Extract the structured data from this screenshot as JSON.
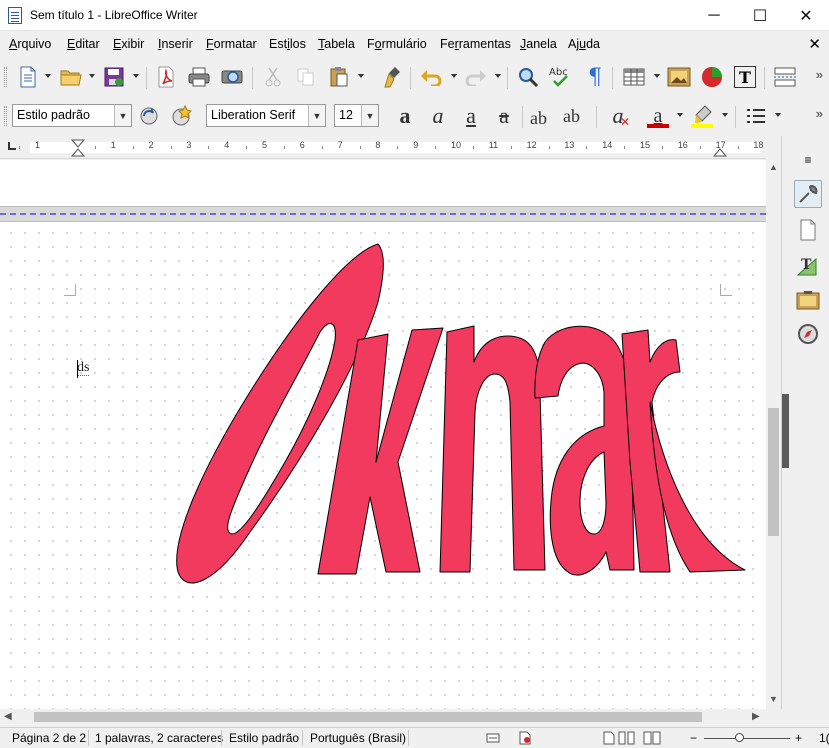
{
  "window": {
    "title": "Sem título 1 - LibreOffice Writer",
    "controls": {
      "minimize": "─",
      "maximize": "☐",
      "close": "✕"
    }
  },
  "menu": {
    "items": [
      {
        "accel": "A",
        "rest": "rquivo"
      },
      {
        "accel": "E",
        "rest": "ditar"
      },
      {
        "accel": "E",
        "rest": "xibir"
      },
      {
        "accel": "I",
        "rest": "nserir"
      },
      {
        "accel": "F",
        "rest": "ormatar"
      },
      {
        "pre": "Est",
        "accel": "i",
        "rest": "los"
      },
      {
        "accel": "T",
        "rest": "abela"
      },
      {
        "pre": "F",
        "accel": "o",
        "rest": "rmulário"
      },
      {
        "pre": "Fe",
        "accel": "r",
        "rest": "ramentas"
      },
      {
        "accel": "J",
        "rest": "anela"
      },
      {
        "pre": "Aj",
        "accel": "u",
        "rest": "da"
      }
    ],
    "close_doc": "✕"
  },
  "standard_toolbar": {
    "more": "»",
    "icons": [
      "new-document-icon",
      "open-icon",
      "save-icon",
      "export-pdf-icon",
      "print-icon",
      "print-preview-icon",
      "cut-icon",
      "copy-icon",
      "paste-icon",
      "clone-formatting-icon",
      "undo-icon",
      "redo-icon",
      "find-replace-icon",
      "spelling-icon",
      "formatting-marks-icon",
      "insert-table-icon",
      "insert-image-icon",
      "insert-chart-icon",
      "insert-textbox-icon",
      "insert-page-break-icon"
    ],
    "spelling_label": "Abc",
    "textbox_label": "T",
    "formatting_marks_glyph": "¶"
  },
  "formatting_toolbar": {
    "paragraph_style": "Estilo padrão",
    "font_name": "Liberation Serif",
    "font_size": "12",
    "bold_glyph": "a",
    "italic_glyph": "a",
    "underline_glyph": "a",
    "strike_glyph": "a",
    "superscript_glyph": "ab",
    "subscript_glyph": "ab",
    "clear_glyph": "a",
    "font_color_glyph": "a",
    "font_color": "#cc0000",
    "highlight_color": "#ffff00",
    "more": "»"
  },
  "ruler": {
    "labels": [
      "1",
      "1",
      "2",
      "3",
      "4",
      "5",
      "6",
      "7",
      "8",
      "9",
      "10",
      "11",
      "12",
      "13",
      "14",
      "15",
      "16",
      "17",
      "18"
    ]
  },
  "document": {
    "text": "ds",
    "fontwork_color": "#f23a5f"
  },
  "sidebar": {
    "menu_glyph": "≡",
    "textbox_glyph": "T",
    "icons": [
      "sidebar-menu-icon",
      "properties-icon",
      "page-icon",
      "styles-icon",
      "gallery-icon",
      "navigator-icon"
    ]
  },
  "scrollbars": {
    "up": "▲",
    "down": "▼",
    "left": "◀",
    "right": "▶"
  },
  "status": {
    "page": "Página 2 de 2",
    "words": "1 palavras, 2 caracteres",
    "style": "Estilo padrão",
    "language": "Português (Brasil)",
    "zoom_minus": "−",
    "zoom_plus": "+",
    "zoom_value": "1("
  }
}
